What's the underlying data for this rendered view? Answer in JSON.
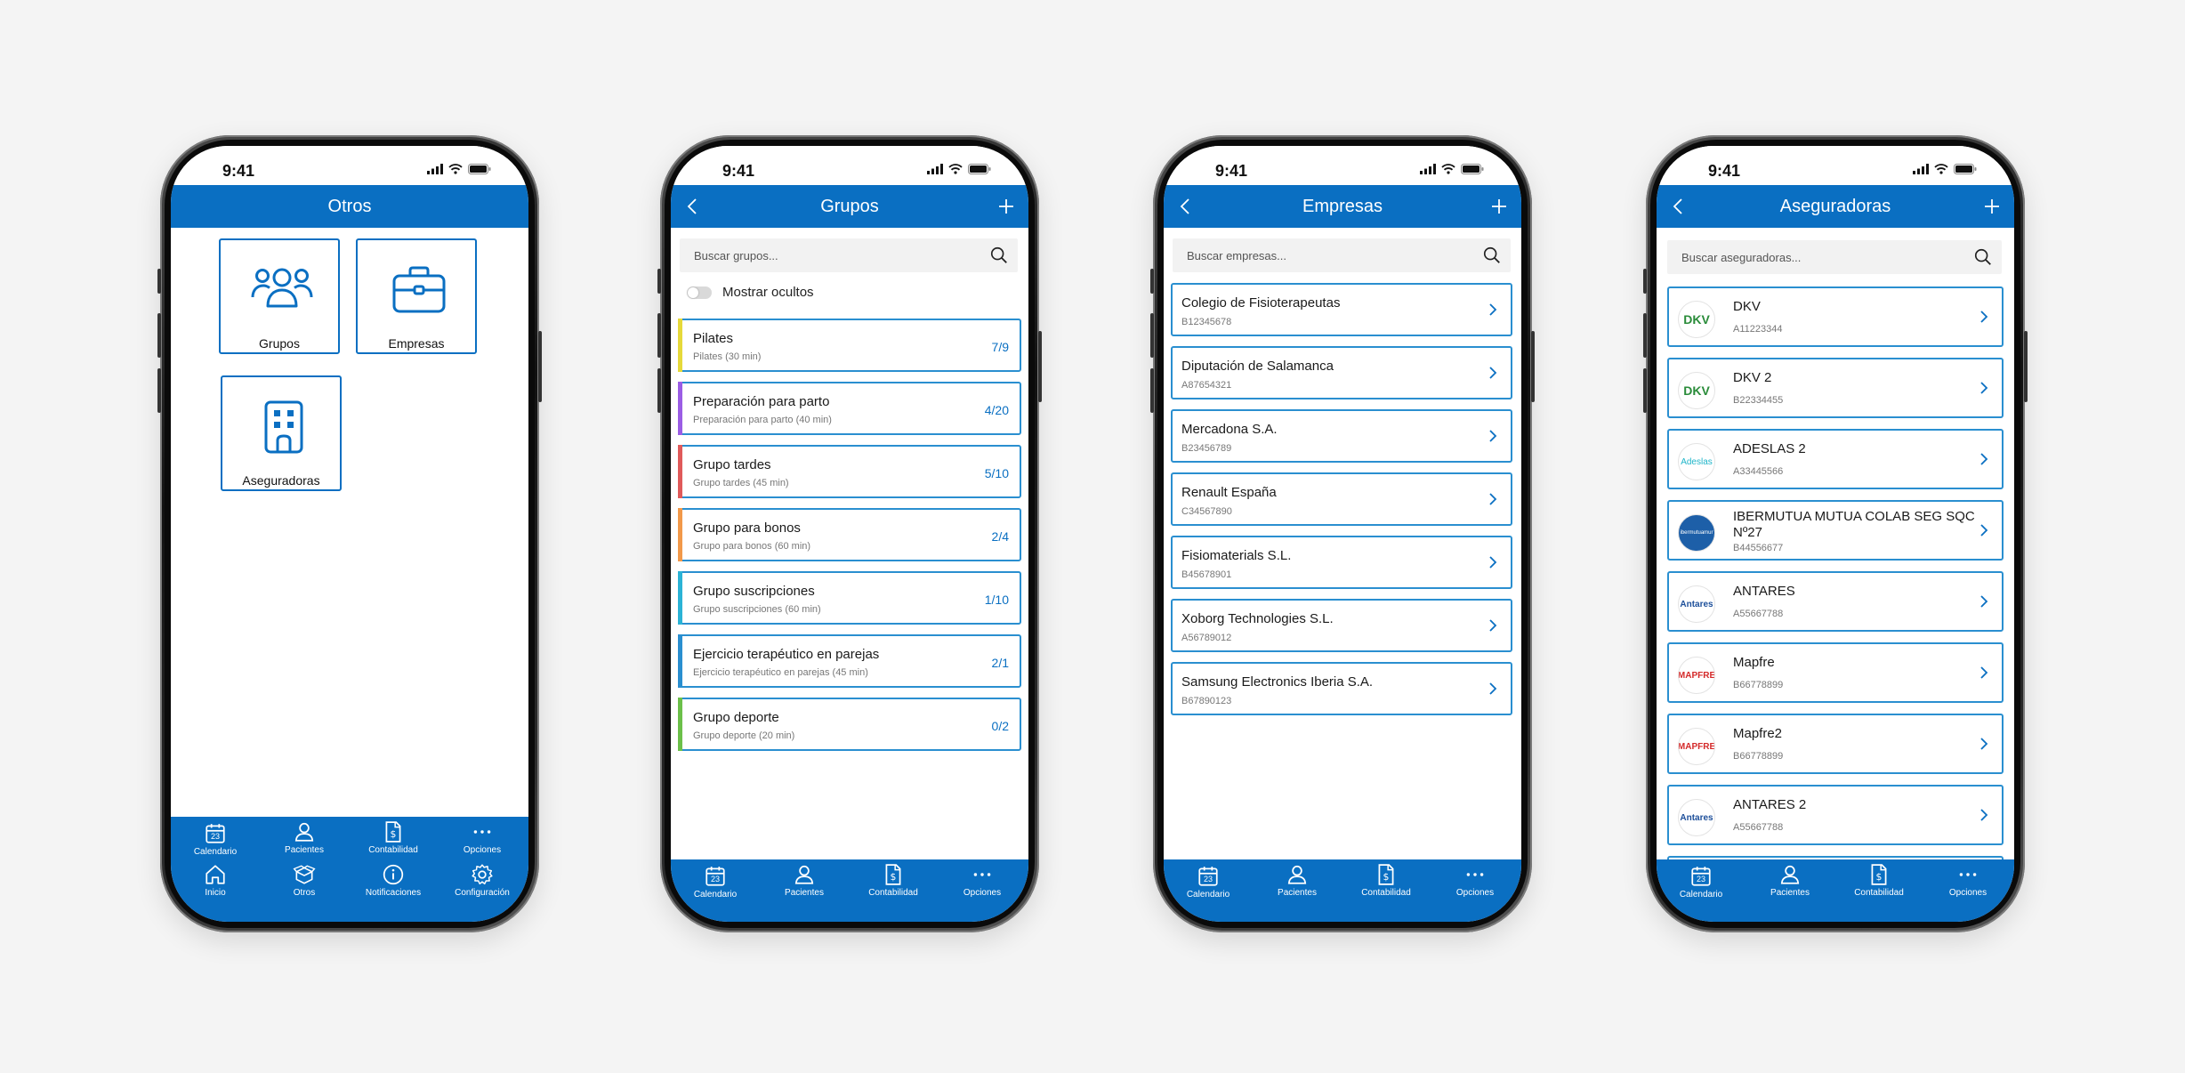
{
  "status_time": "9:41",
  "colors": {
    "brand": "#0a6fc2",
    "card_border": "#2a8fd0",
    "count": "#0a6fc2"
  },
  "screens": {
    "otros": {
      "title": "Otros",
      "tiles": [
        {
          "label": "Grupos",
          "icon": "people-icon"
        },
        {
          "label": "Empresas",
          "icon": "briefcase-icon"
        },
        {
          "label": "Aseguradoras",
          "icon": "building-icon"
        }
      ],
      "tabs_top": [
        {
          "label": "Calendario",
          "icon": "calendar-icon",
          "day": "23"
        },
        {
          "label": "Pacientes",
          "icon": "person-icon"
        },
        {
          "label": "Contabilidad",
          "icon": "invoice-icon"
        },
        {
          "label": "Opciones",
          "icon": "more-icon"
        }
      ],
      "tabs_bottom": [
        {
          "label": "Inicio",
          "icon": "home-icon"
        },
        {
          "label": "Otros",
          "icon": "box-icon"
        },
        {
          "label": "Notificaciones",
          "icon": "info-icon"
        },
        {
          "label": "Configuración",
          "icon": "gear-icon"
        }
      ]
    },
    "grupos": {
      "title": "Grupos",
      "search_placeholder": "Buscar grupos...",
      "toggle_label": "Mostrar ocultos",
      "toggle_on": false,
      "items": [
        {
          "name": "Pilates",
          "sub": "Pilates (30 min)",
          "count": "7/9",
          "color": "#e6d93a"
        },
        {
          "name": "Preparación para parto",
          "sub": "Preparación para parto (40 min)",
          "count": "4/20",
          "color": "#9b5de5"
        },
        {
          "name": "Grupo tardes",
          "sub": "Grupo tardes (45 min)",
          "count": "5/10",
          "color": "#e05a5a"
        },
        {
          "name": "Grupo para bonos",
          "sub": "Grupo para bonos (60 min)",
          "count": "2/4",
          "color": "#f2994a"
        },
        {
          "name": "Grupo suscripciones",
          "sub": "Grupo suscripciones (60 min)",
          "count": "1/10",
          "color": "#2bb3d6"
        },
        {
          "name": "Ejercicio terapéutico en parejas",
          "sub": "Ejercicio terapéutico en parejas (45 min)",
          "count": "2/1",
          "color": "#2a8fd0"
        },
        {
          "name": "Grupo deporte",
          "sub": "Grupo deporte (20 min)",
          "count": "0/2",
          "color": "#6cc04a"
        }
      ]
    },
    "empresas": {
      "title": "Empresas",
      "search_placeholder": "Buscar empresas...",
      "items": [
        {
          "name": "Colegio de Fisioterapeutas",
          "sub": "B12345678"
        },
        {
          "name": "Diputación de Salamanca",
          "sub": "A87654321"
        },
        {
          "name": "Mercadona S.A.",
          "sub": "B23456789"
        },
        {
          "name": "Renault España",
          "sub": "C34567890"
        },
        {
          "name": "Fisiomaterials S.L.",
          "sub": "B45678901"
        },
        {
          "name": "Xoborg Technologies S.L.",
          "sub": "A56789012"
        },
        {
          "name": "Samsung Electronics Iberia S.A.",
          "sub": "B67890123"
        }
      ]
    },
    "aseguradoras": {
      "title": "Aseguradoras",
      "search_placeholder": "Buscar aseguradoras...",
      "items": [
        {
          "name": "DKV",
          "sub": "A11223344",
          "logo": "DKV",
          "logo_color": "#2a8c3a"
        },
        {
          "name": "DKV 2",
          "sub": "B22334455",
          "logo": "DKV",
          "logo_color": "#2a8c3a"
        },
        {
          "name": "ADESLAS 2",
          "sub": "A33445566",
          "logo": "Adeslas",
          "logo_color": "#1fb5c9"
        },
        {
          "name": "IBERMUTUA MUTUA COLAB SEG SQC Nº27",
          "sub": "B44556677",
          "logo": "ibermutuamur",
          "logo_color": "#1d5fa8"
        },
        {
          "name": "ANTARES",
          "sub": "A55667788",
          "logo": "Antares",
          "logo_color": "#1d4f9a"
        },
        {
          "name": "Mapfre",
          "sub": "B66778899",
          "logo": "MAPFRE",
          "logo_color": "#d42a2a"
        },
        {
          "name": "Mapfre2",
          "sub": "B66778899",
          "logo": "MAPFRE",
          "logo_color": "#d42a2a"
        },
        {
          "name": "ANTARES 2",
          "sub": "A55667788",
          "logo": "Antares",
          "logo_color": "#1d4f9a"
        }
      ]
    },
    "tabs": [
      {
        "label": "Calendario",
        "icon": "calendar-icon",
        "day": "23"
      },
      {
        "label": "Pacientes",
        "icon": "person-icon"
      },
      {
        "label": "Contabilidad",
        "icon": "invoice-icon"
      },
      {
        "label": "Opciones",
        "icon": "more-icon"
      }
    ]
  }
}
